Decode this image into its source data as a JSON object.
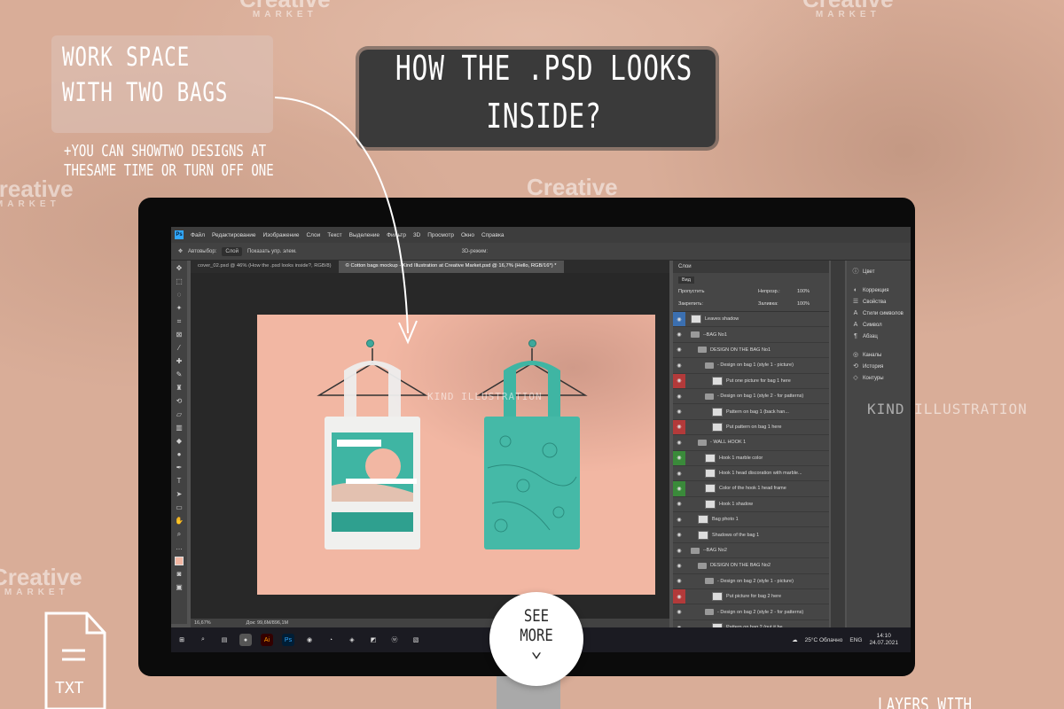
{
  "promo": {
    "workspace_line1": "WORK SPACE",
    "workspace_line2": "WITH TWO BAGS",
    "note_line1": "+YOU CAN SHOWTWO DESIGNS AT",
    "note_line2": "THESAME TIME OR TURN OFF ONE",
    "headline_line1": "HOW THE .PSD LOOKS",
    "headline_line2": "INSIDE?",
    "see_more_line1": "SEE",
    "see_more_line2": "MORE",
    "bottom_text": "LAYERS WITH",
    "txt_label": "TXT",
    "watermark": "Creative",
    "watermark_sub": "MARKET",
    "kind_mark": "KIND ILLUSTRATION"
  },
  "photoshop": {
    "menu": [
      "Файл",
      "Редактирование",
      "Изображение",
      "Слои",
      "Текст",
      "Выделение",
      "Фильтр",
      "3D",
      "Просмотр",
      "Окно",
      "Справка"
    ],
    "options": {
      "autoselect": "Автовыбор:",
      "autoselect_value": "Слой",
      "transform": "Показать упр. элем.",
      "mode_3d": "3D-режим:"
    },
    "tabs": [
      "cover_02.psd @ 46% (How the .psd looks inside?, RGB/8)",
      "© Cotton bags mockup - Kind Illustration at Creative Market.psd @ 16,7% (Hello, RGB/16*) *"
    ],
    "status_zoom": "16,67%",
    "status_doc": "Док: 99,6M/896,1M",
    "layers_panel": {
      "title": "Слои",
      "filter": "Вид",
      "blend": "Пропустить",
      "opacity_label": "Непрозр.:",
      "opacity_value": "100%",
      "lock_label": "Закрепить:",
      "fill_label": "Заливка:",
      "fill_value": "100%",
      "layers": [
        {
          "name": "Leaves shadow",
          "indent": 0,
          "kind": "thumb",
          "eye": "#3b6fb0"
        },
        {
          "name": "--BAG No1",
          "indent": 0,
          "kind": "folder",
          "eye": ""
        },
        {
          "name": "DESIGN ON THE BAG No1",
          "indent": 1,
          "kind": "folder",
          "eye": ""
        },
        {
          "name": "- Design on bag 1 (style 1 - picture)",
          "indent": 2,
          "kind": "folder",
          "eye": ""
        },
        {
          "name": "Put one picture for bag 1 here",
          "indent": 3,
          "kind": "thumb",
          "eye": "#b33a3a"
        },
        {
          "name": "- Design on bag 1 (style 2 - for patterns)",
          "indent": 2,
          "kind": "folder",
          "eye": ""
        },
        {
          "name": "Pattern on bag 1 (back han...",
          "indent": 3,
          "kind": "thumb",
          "eye": ""
        },
        {
          "name": "Put pattern on bag 1 here",
          "indent": 3,
          "kind": "thumb",
          "eye": "#b33a3a"
        },
        {
          "name": "- WALL HOOK 1",
          "indent": 1,
          "kind": "folder",
          "eye": ""
        },
        {
          "name": "Hook 1 marble color",
          "indent": 2,
          "kind": "thumb",
          "eye": "#3a8a3a"
        },
        {
          "name": "Hook 1 head discoration with marble...",
          "indent": 2,
          "kind": "thumb",
          "eye": ""
        },
        {
          "name": "Color of the hook 1 head frame",
          "indent": 2,
          "kind": "thumb",
          "eye": "#3a8a3a"
        },
        {
          "name": "Hook 1 shadow",
          "indent": 2,
          "kind": "thumb",
          "eye": ""
        },
        {
          "name": "Bag photo 1",
          "indent": 1,
          "kind": "thumb",
          "eye": ""
        },
        {
          "name": "Shadows of the bag 1",
          "indent": 1,
          "kind": "thumb",
          "eye": ""
        },
        {
          "name": "--BAG No2",
          "indent": 0,
          "kind": "folder",
          "eye": ""
        },
        {
          "name": "DESIGN ON THE BAG No2",
          "indent": 1,
          "kind": "folder",
          "eye": ""
        },
        {
          "name": "- Design on bag 2 (style 1 - picture)",
          "indent": 2,
          "kind": "folder",
          "eye": ""
        },
        {
          "name": "Put picture for bag 2 here",
          "indent": 3,
          "kind": "thumb",
          "eye": "#b33a3a"
        },
        {
          "name": "- Design on bag 2 (style 2 - for patterns)",
          "indent": 2,
          "kind": "folder",
          "eye": ""
        },
        {
          "name": "Pattern on bag 2 (put it he...",
          "indent": 3,
          "kind": "thumb",
          "eye": ""
        }
      ]
    },
    "right_panel": [
      {
        "icon": "info-icon",
        "glyph": "ⓘ",
        "label": "Цвет"
      },
      {
        "icon": "correction-icon",
        "glyph": "◐",
        "label": "Коррекция"
      },
      {
        "icon": "properties-icon",
        "glyph": "☰",
        "label": "Свойства"
      },
      {
        "icon": "char-styles-icon",
        "glyph": "A",
        "label": "Стили символов"
      },
      {
        "icon": "char-icon",
        "glyph": "A",
        "label": "Символ"
      },
      {
        "icon": "paragraph-icon",
        "glyph": "¶",
        "label": "Абзац"
      },
      {
        "icon": "channels-icon",
        "glyph": "◎",
        "label": "Каналы"
      },
      {
        "icon": "history-icon",
        "glyph": "⟲",
        "label": "История"
      },
      {
        "icon": "paths-icon",
        "glyph": "◇",
        "label": "Контуры"
      }
    ],
    "taskbar": {
      "weather": "25°C Облачно",
      "lang": "ENG",
      "time": "14:10",
      "date": "24.07.2021"
    }
  },
  "colors": {
    "background": "#d9ad98",
    "artboard": "#f2b7a3",
    "teal": "#3fb5a3"
  }
}
